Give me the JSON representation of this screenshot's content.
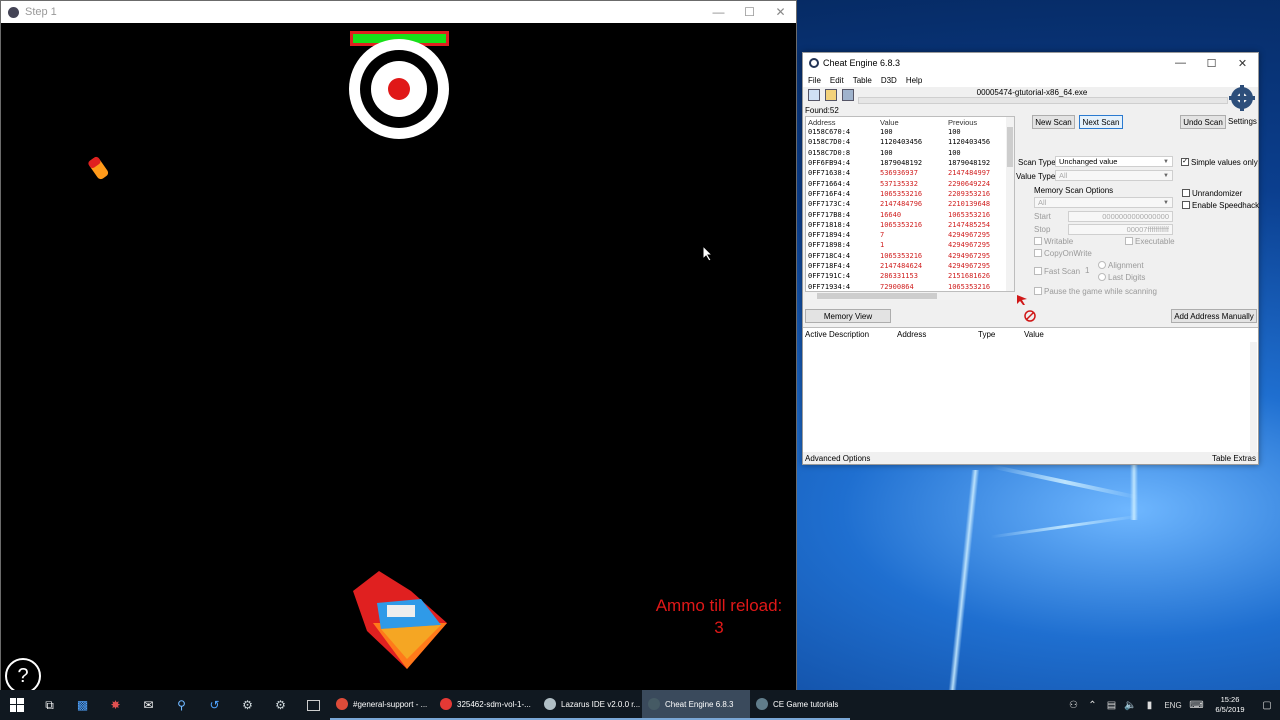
{
  "game": {
    "title": "Step 1",
    "ammo_label": "Ammo till reload:",
    "ammo_count": "3",
    "help_label": "?",
    "health_bar_fill": 1.0
  },
  "cheat_engine": {
    "title": "Cheat Engine 6.8.3",
    "menu": [
      "File",
      "Edit",
      "Table",
      "D3D",
      "Help"
    ],
    "process": "00005474-gtutorial-x86_64.exe",
    "found": "Found:52",
    "columns": {
      "address": "Address",
      "value": "Value",
      "previous": "Previous"
    },
    "results": [
      {
        "address": "0158C670:4",
        "value": "100",
        "previous": "100",
        "changed": false
      },
      {
        "address": "0158C7D0:4",
        "value": "1120403456",
        "previous": "1120403456",
        "changed": false
      },
      {
        "address": "0158C7D0:8",
        "value": "100",
        "previous": "100",
        "changed": false
      },
      {
        "address": "0FF6FB94:4",
        "value": "1879048192",
        "previous": "1879048192",
        "changed": false
      },
      {
        "address": "0FF71638:4",
        "value": "536936937",
        "previous": "2147484997",
        "changed": true
      },
      {
        "address": "0FF71664:4",
        "value": "537135332",
        "previous": "2290649224",
        "changed": true
      },
      {
        "address": "0FF716F4:4",
        "value": "1065353216",
        "previous": "2209353216",
        "changed": true
      },
      {
        "address": "0FF7173C:4",
        "value": "2147484796",
        "previous": "2210139648",
        "changed": true
      },
      {
        "address": "0FF717B8:4",
        "value": "16640",
        "previous": "1065353216",
        "changed": true
      },
      {
        "address": "0FF71818:4",
        "value": "1065353216",
        "previous": "2147485254",
        "changed": true
      },
      {
        "address": "0FF71894:4",
        "value": "7",
        "previous": "4294967295",
        "changed": true
      },
      {
        "address": "0FF71898:4",
        "value": "1",
        "previous": "4294967295",
        "changed": true
      },
      {
        "address": "0FF718C4:4",
        "value": "1065353216",
        "previous": "4294967295",
        "changed": true
      },
      {
        "address": "0FF718F4:4",
        "value": "2147484624",
        "previous": "4294967295",
        "changed": true
      },
      {
        "address": "0FF7191C:4",
        "value": "286331153",
        "previous": "2151681626",
        "changed": true
      },
      {
        "address": "0FF71934:4",
        "value": "72900864",
        "previous": "1065353216",
        "changed": true
      }
    ],
    "buttons": {
      "new_scan": "New Scan",
      "next_scan": "Next Scan",
      "undo_scan": "Undo Scan",
      "settings": "Settings",
      "memory_view": "Memory View",
      "add_address": "Add Address Manually"
    },
    "scan_type_label": "Scan Type",
    "scan_type_value": "Unchanged value",
    "value_type_label": "Value Type",
    "value_type_value": "All",
    "memory_scan_options": "Memory Scan Options",
    "region_value": "All",
    "start_label": "Start",
    "start_value": "0000000000000000",
    "stop_label": "Stop",
    "stop_value": "00007fffffffffff",
    "writable": "Writable",
    "executable": "Executable",
    "copy_on_write": "CopyOnWrite",
    "fast_scan": "Fast Scan",
    "fast_scan_value": "1",
    "alignment": "Alignment",
    "last_digits": "Last Digits",
    "pause_game": "Pause the game while scanning",
    "simple_values": "Simple values only",
    "unrandomizer": "Unrandomizer",
    "enable_speedhack": "Enable Speedhack",
    "address_list_columns": [
      "Active Description",
      "Address",
      "Type",
      "Value"
    ],
    "advanced_options": "Advanced Options",
    "table_extras": "Table Extras"
  },
  "taskbar": {
    "items": [
      {
        "label": "#general-support - ...",
        "color": "#dd4b39",
        "active": false
      },
      {
        "label": "325462-sdm-vol-1-...",
        "color": "#e53935",
        "active": false
      },
      {
        "label": "Lazarus IDE v2.0.0 r...",
        "color": "#b0bec5",
        "active": false
      },
      {
        "label": "Cheat Engine 6.8.3",
        "color": "#455a64",
        "active": true
      },
      {
        "label": "CE Game tutorials",
        "color": "#607d8b",
        "active": false
      }
    ],
    "language": "ENG",
    "time": "15:26",
    "date": "6/5/2019"
  }
}
